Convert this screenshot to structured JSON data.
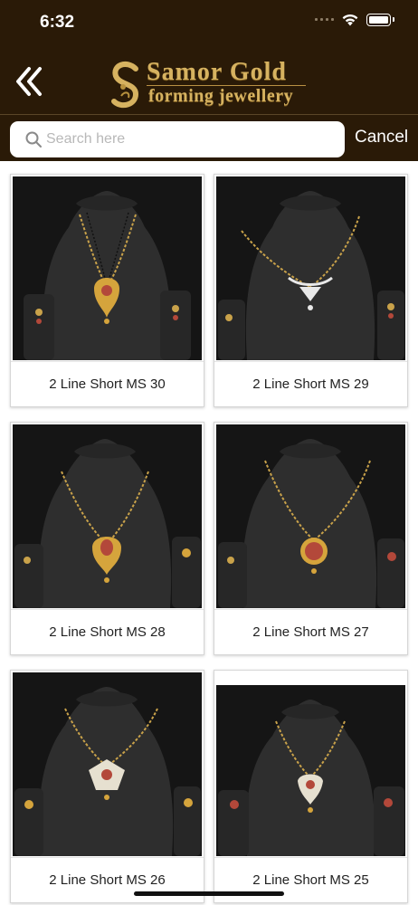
{
  "status_bar": {
    "time": "6:32"
  },
  "header": {
    "back_icon": "double-chevron-left-icon",
    "logo_title": "Samor Gold",
    "logo_subtitle": "forming jewellery"
  },
  "search": {
    "placeholder": "Search here",
    "value": "",
    "cancel_label": "Cancel"
  },
  "products": [
    {
      "name": "2 Line Short MS 30"
    },
    {
      "name": "2 Line Short MS 29"
    },
    {
      "name": "2 Line Short MS 28"
    },
    {
      "name": "2 Line Short MS 27"
    },
    {
      "name": "2 Line Short MS 26"
    },
    {
      "name": "2 Line Short MS 25"
    }
  ],
  "colors": {
    "header_bg": "#2a1a07",
    "gold": "#d6b260"
  }
}
